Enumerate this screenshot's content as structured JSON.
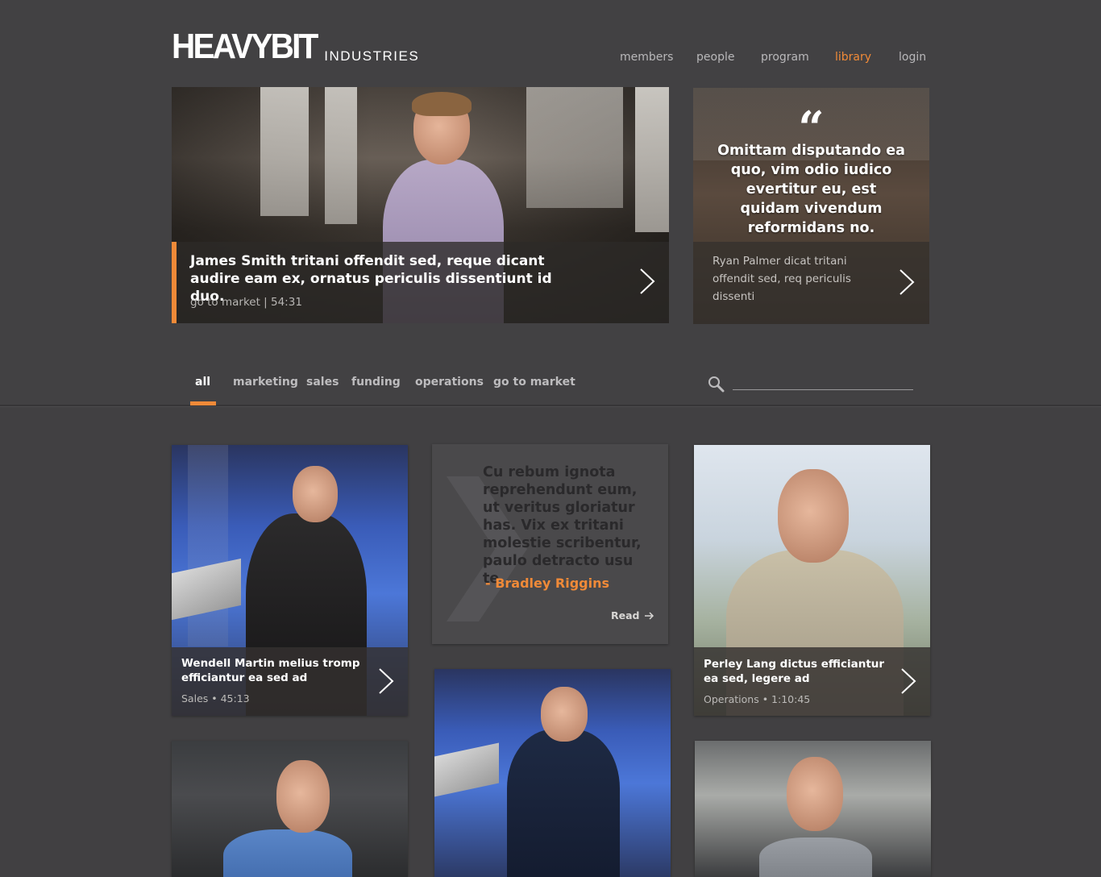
{
  "brand": {
    "main": "HEAVYBIT",
    "sub": "INDUSTRIES"
  },
  "nav": {
    "items": [
      {
        "label": "members"
      },
      {
        "label": "people"
      },
      {
        "label": "program"
      },
      {
        "label": "library",
        "active": true
      },
      {
        "label": "login"
      }
    ]
  },
  "hero": {
    "title": "James Smith tritani offendit sed, reque dicant audire eam ex, ornatus periculis dissentiunt id duo.",
    "meta": "go to market | 54:31"
  },
  "quote_card": {
    "mark": "“",
    "text": "Omittam disputando ea quo, vim odio iudico evertitur eu, est quidam vivendum reformidans no.",
    "caption": "Ryan Palmer dicat tritani offendit sed, req periculis dissenti"
  },
  "filters": {
    "tabs": [
      {
        "label": "all",
        "active": true
      },
      {
        "label": "marketing"
      },
      {
        "label": "sales"
      },
      {
        "label": "funding"
      },
      {
        "label": "operations"
      },
      {
        "label": "go to market"
      }
    ],
    "search_placeholder": ""
  },
  "cards": [
    {
      "title": "Wendell Martin melius tromp efficiantur ea sed ad",
      "meta": "Sales  •  45:13"
    },
    {
      "title": "Perley Lang dictus efficiantur ea sed, legere ad",
      "meta": "Operations  •  1:10:45"
    }
  ],
  "text_card": {
    "quote": "Cu rebum ignota reprehendunt eum, ut veritus gloriatur has. Vix ex tritani molestie scribentur, paulo detracto usu te.",
    "author": "- Bradley Riggins",
    "read_label": "Read"
  },
  "colors": {
    "accent": "#f08a38",
    "background": "#414042"
  },
  "icons": {
    "search": "search-icon",
    "next": "chevron-right-icon",
    "read_arrow": "arrow-right-icon"
  }
}
